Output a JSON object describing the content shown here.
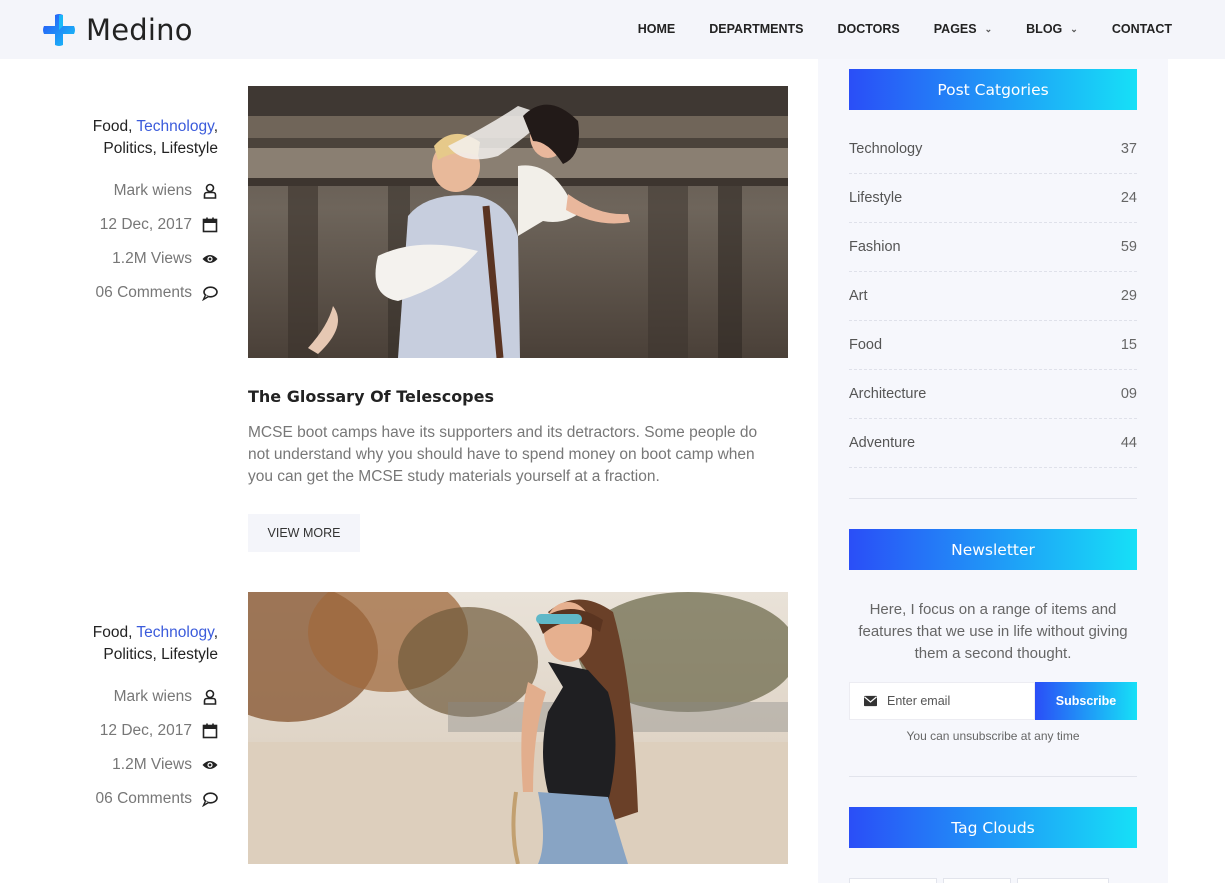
{
  "brand": {
    "name": "Medino"
  },
  "nav": {
    "items": [
      {
        "label": "HOME",
        "dropdown": false
      },
      {
        "label": "DEPARTMENTS",
        "dropdown": false
      },
      {
        "label": "DOCTORS",
        "dropdown": false
      },
      {
        "label": "PAGES",
        "dropdown": true
      },
      {
        "label": "BLOG",
        "dropdown": true
      },
      {
        "label": "CONTACT",
        "dropdown": false
      }
    ]
  },
  "posts": [
    {
      "categories": {
        "c1": "Food",
        "c2": "Technology",
        "c3": "Politics",
        "c4": "Lifestyle"
      },
      "author": "Mark wiens",
      "date": "12 Dec, 2017",
      "views": "1.2M Views",
      "comments": "06 Comments",
      "title": "The Glossary Of Telescopes",
      "excerpt": "MCSE boot camps have its supporters and its detractors. Some people do not understand why you should have to spend money on boot camp when you can get the MCSE study materials yourself at a fraction.",
      "button_label": "VIEW MORE"
    },
    {
      "categories": {
        "c1": "Food",
        "c2": "Technology",
        "c3": "Politics",
        "c4": "Lifestyle"
      },
      "author": "Mark wiens",
      "date": "12 Dec, 2017",
      "views": "1.2M Views",
      "comments": "06 Comments"
    }
  ],
  "sidebar": {
    "categories_title": "Post Catgories",
    "categories": [
      {
        "name": "Technology",
        "count": "37"
      },
      {
        "name": "Lifestyle",
        "count": "24"
      },
      {
        "name": "Fashion",
        "count": "59"
      },
      {
        "name": "Art",
        "count": "29"
      },
      {
        "name": "Food",
        "count": "15"
      },
      {
        "name": "Architecture",
        "count": "09"
      },
      {
        "name": "Adventure",
        "count": "44"
      }
    ],
    "newsletter": {
      "title": "Newsletter",
      "text": "Here, I focus on a range of items and features that we use in life without giving them a second thought.",
      "placeholder": "Enter email",
      "button": "Subscribe",
      "note": "You can unsubscribe at any time"
    },
    "tags_title": "Tag Clouds"
  },
  "colors": {
    "accent_start": "#2a4ef7",
    "accent_end": "#16e0f7",
    "link": "#3b5bdb"
  },
  "icons": {
    "logo": "cross-logo-icon",
    "author": "user-icon",
    "date": "calendar-icon",
    "views": "eye-icon",
    "comments": "comment-icon",
    "email": "envelope-icon"
  }
}
